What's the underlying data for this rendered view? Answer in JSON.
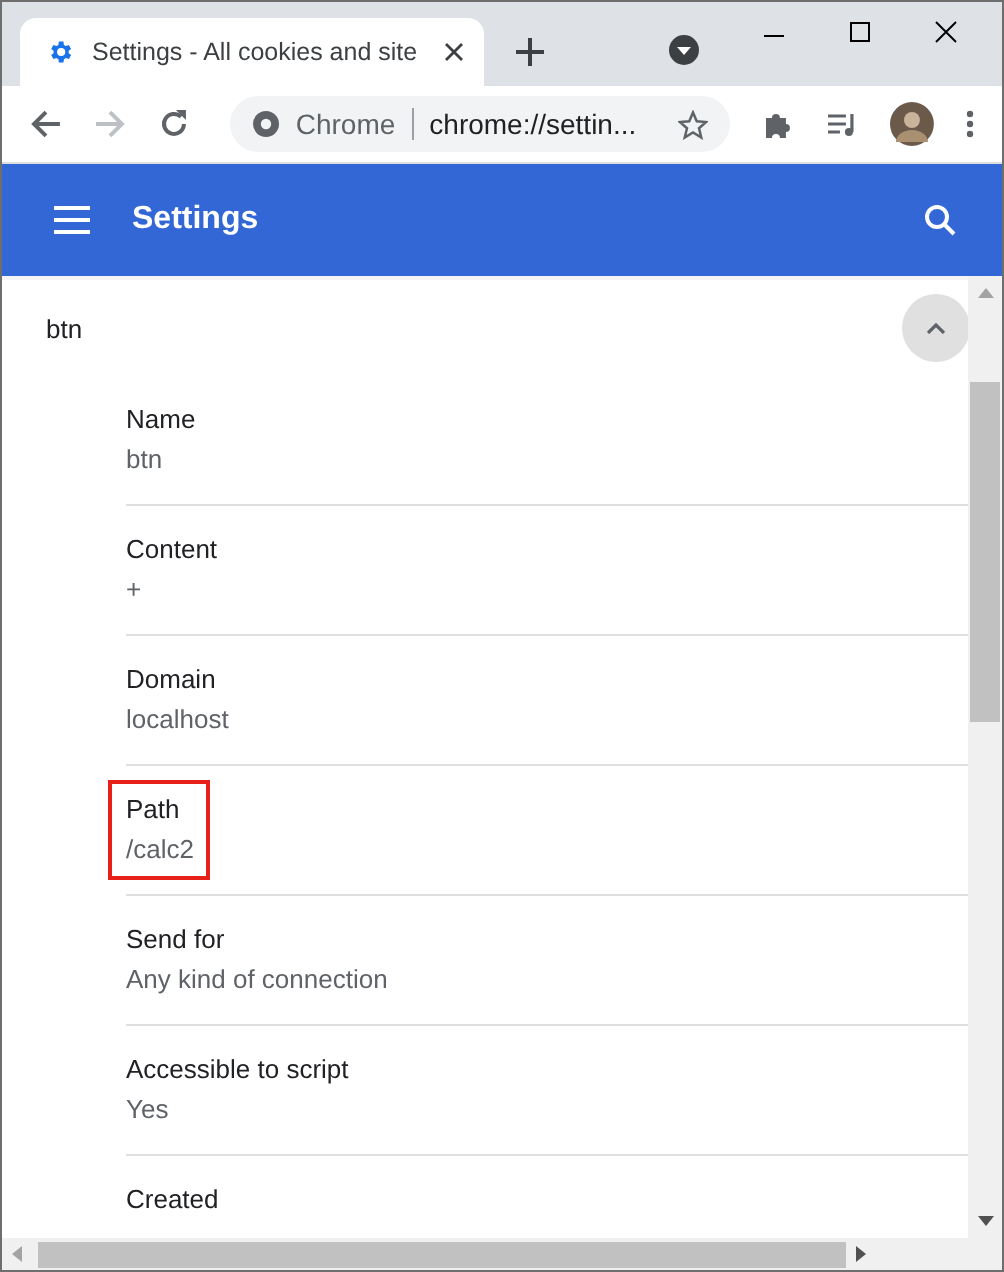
{
  "browser": {
    "tab_title": "Settings - All cookies and site",
    "address_site": "Chrome",
    "address_url": "chrome://settin..."
  },
  "header": {
    "title": "Settings"
  },
  "cookie": {
    "name": "btn",
    "expanded": true,
    "fields": [
      {
        "label": "Name",
        "value": "btn",
        "highlighted": false
      },
      {
        "label": "Content",
        "value": "+",
        "highlighted": false
      },
      {
        "label": "Domain",
        "value": "localhost",
        "highlighted": false
      },
      {
        "label": "Path",
        "value": "/calc2",
        "highlighted": true
      },
      {
        "label": "Send for",
        "value": "Any kind of connection",
        "highlighted": false
      },
      {
        "label": "Accessible to script",
        "value": "Yes",
        "highlighted": false
      },
      {
        "label": "Created",
        "highlighted": false
      }
    ]
  }
}
